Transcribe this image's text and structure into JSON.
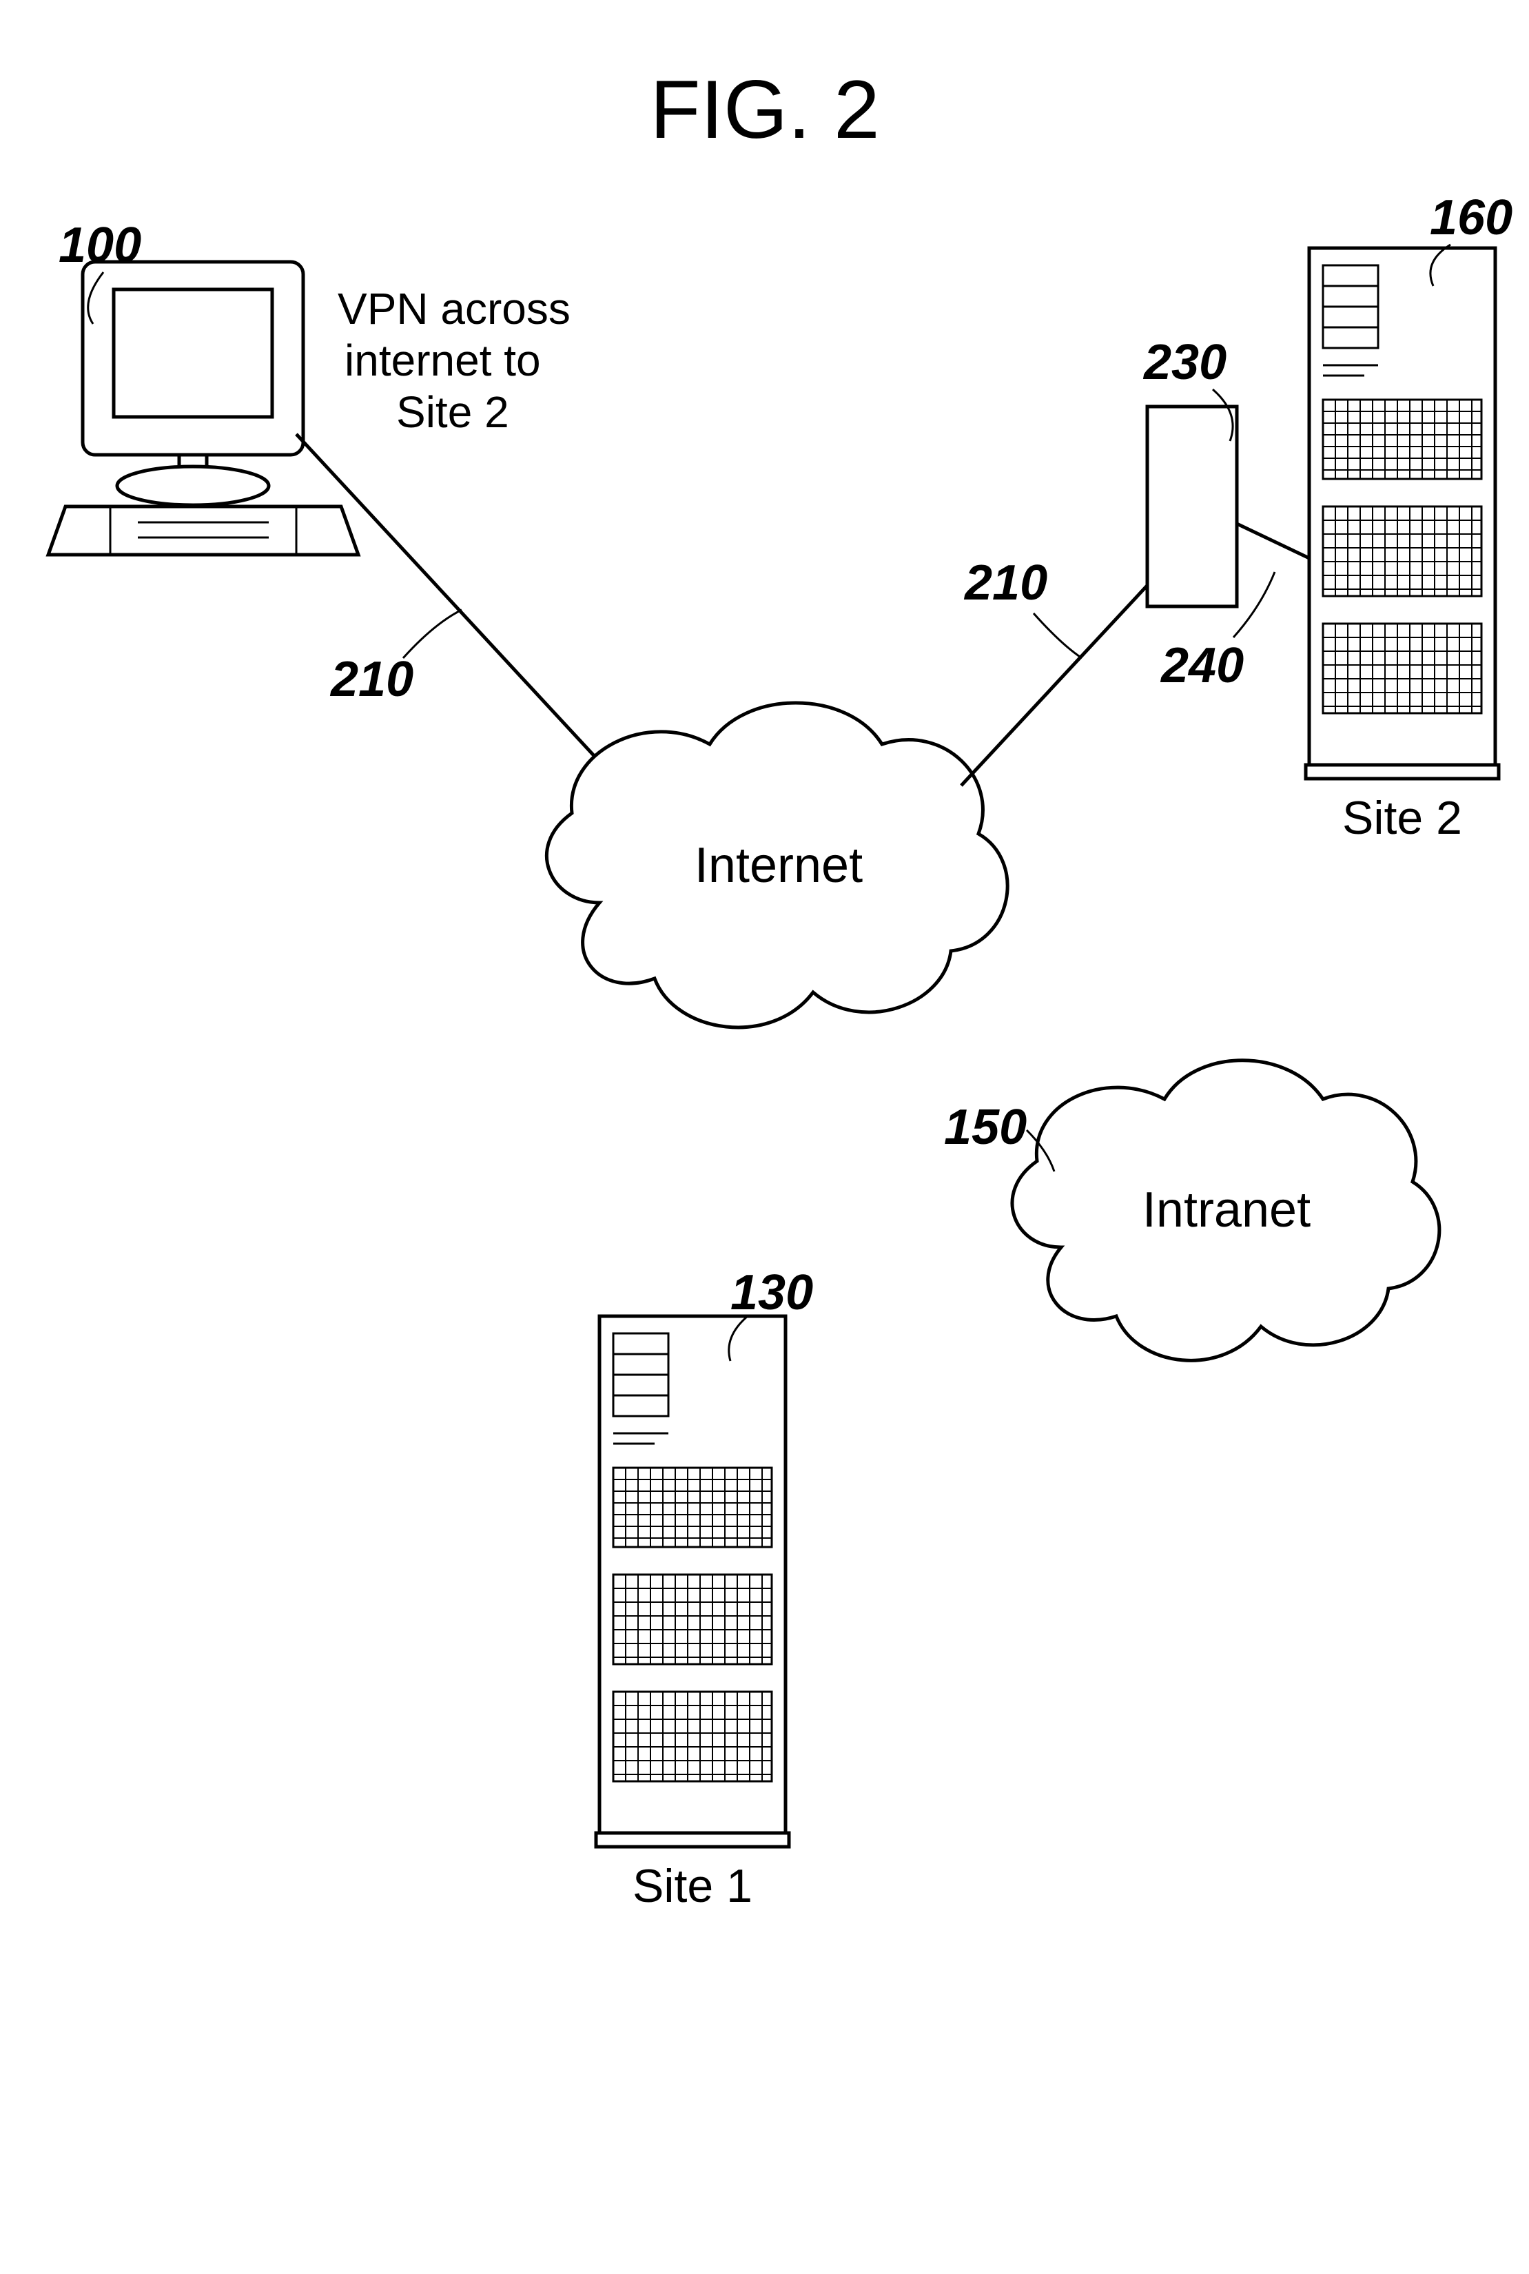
{
  "figure_title": "FIG. 2",
  "vpn_label_line1": "VPN across",
  "vpn_label_line2": "internet to",
  "vpn_label_line3": "Site 2",
  "cloud_internet": "Internet",
  "cloud_intranet": "Intranet",
  "site1_label": "Site 1",
  "site2_label": "Site 2",
  "ref": {
    "client": "100",
    "server_site1": "130",
    "server_site2": "160",
    "intranet_cloud": "150",
    "vpn_left": "210",
    "vpn_right": "210",
    "gateway": "230",
    "gateway_link": "240"
  }
}
